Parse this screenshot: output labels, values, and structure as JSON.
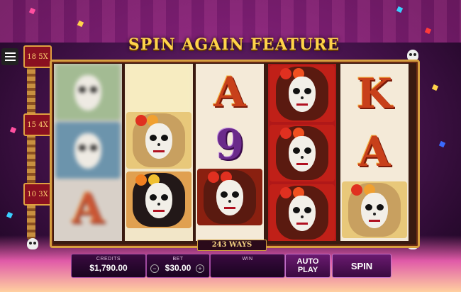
{
  "header": {
    "title": "SPIN AGAIN FEATURE"
  },
  "levels": [
    {
      "label": "18 5X"
    },
    {
      "label": "15 4X"
    },
    {
      "label": "10 3X"
    }
  ],
  "reels": [
    [
      "blurred-skull",
      "blurred-skull",
      "A"
    ],
    [
      "blurred-symbol",
      "calavera-blonde",
      "calavera-dark"
    ],
    [
      "A",
      "9",
      "calavera-red-bg"
    ],
    [
      "calavera-red-bg",
      "calavera-red-bg",
      "calavera-red-bg"
    ],
    [
      "K",
      "A",
      "calavera-blonde"
    ]
  ],
  "ways": {
    "label": "243 WAYS"
  },
  "controls": {
    "credits_label": "CREDITS",
    "credits_value": "$1,790.00",
    "bet_label": "BET",
    "bet_value": "$30.00",
    "bet_minus": "−",
    "bet_plus": "+",
    "win_label": "WIN",
    "win_value": "",
    "autoplay_label": "AUTO PLAY",
    "spin_label": "SPIN"
  },
  "colors": {
    "accent_gold": "#ffd34a",
    "letter_red": "#c8401a",
    "panel_purple": "#3a0a40"
  }
}
